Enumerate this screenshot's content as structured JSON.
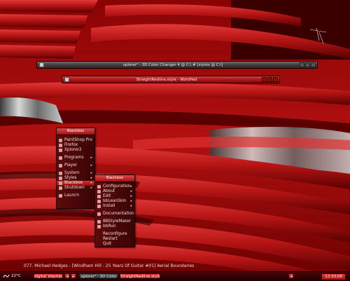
{
  "windows": {
    "explorer_title": "xplorer² - 3D Color Changer 4 @ C:\\ # [styles @ C:\\]",
    "editor_title": "StraightRedline.style - WordPad"
  },
  "root_menu": {
    "title": "Blackbox",
    "items": [
      {
        "label": "PaintShop Pro"
      },
      {
        "label": "Firefox"
      },
      {
        "label": "Xplorer2"
      },
      {
        "label": "Programs"
      },
      {
        "label": "Player"
      },
      {
        "label": "System"
      },
      {
        "label": "Styles"
      },
      {
        "label": "Blackbox"
      },
      {
        "label": "Shutdown"
      },
      {
        "label": "Launch"
      }
    ]
  },
  "style_menu": {
    "title": "Blackbox",
    "items": [
      {
        "label": "Configuration"
      },
      {
        "label": "About"
      },
      {
        "label": "Edit"
      },
      {
        "label": "bbLeanSkin"
      },
      {
        "label": "Install"
      },
      {
        "label": "Documentation"
      },
      {
        "label": "BBStyleMaker"
      },
      {
        "label": "bbRun"
      },
      {
        "label": "Reconfigure"
      },
      {
        "label": "Restart"
      },
      {
        "label": "Quit"
      }
    ]
  },
  "taskbar": {
    "temperature": "22°C",
    "ticker": "077. Michael Hedges - [Windham Hill - 25 Years Of Guitar #01] Aerial Boundaries",
    "workspace": "digital_blackbox",
    "tasks": [
      {
        "label": "xplorer² - 3D Color"
      },
      {
        "label": "StraightRedline.style"
      }
    ],
    "clock": "12:33:06"
  },
  "colors": {
    "accent": "#c01818",
    "menu_bg": "#4a0707",
    "taskbar_bg": "#2a0000"
  }
}
